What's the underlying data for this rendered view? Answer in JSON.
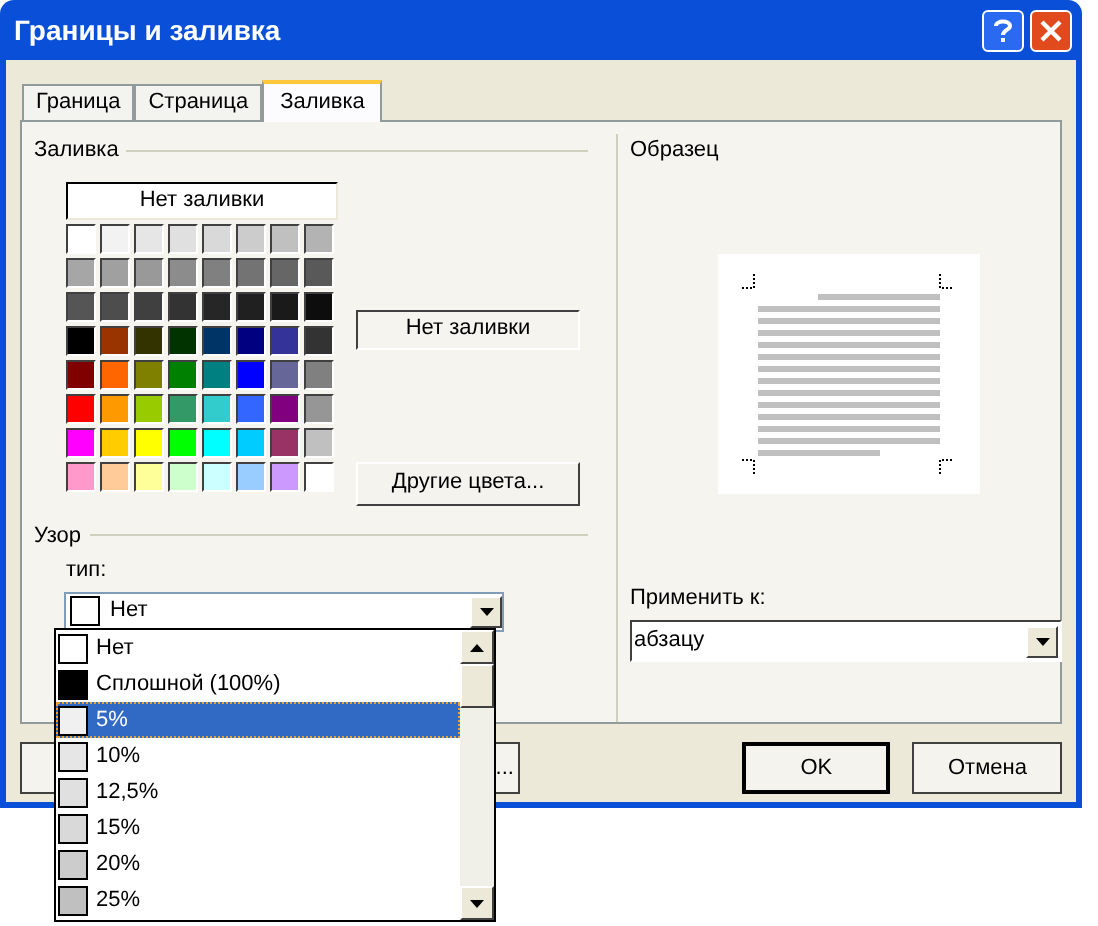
{
  "window": {
    "title": "Границы и заливка"
  },
  "tabs": [
    {
      "label": "Граница",
      "selected": false
    },
    {
      "label": "Страница",
      "selected": false
    },
    {
      "label": "Заливка",
      "selected": true
    }
  ],
  "fill": {
    "title": "Заливка",
    "no_fill_button": "Нет заливки",
    "palette": [
      {
        "swatches": [
          {
            "color": "#ffffff"
          },
          {
            "color": "#f2f2f2"
          },
          {
            "color": "#e6e6e6"
          },
          {
            "color": "#e0e0e0"
          },
          {
            "color": "#d9d9d9"
          },
          {
            "color": "#cccccc"
          },
          {
            "color": "#c0c0c0"
          },
          {
            "color": "#b3b3b3"
          }
        ]
      },
      {
        "swatches": [
          {
            "color": "#a6a6a6"
          },
          {
            "color": "#a0a0a0"
          },
          {
            "color": "#999999"
          },
          {
            "color": "#8c8c8c"
          },
          {
            "color": "#808080"
          },
          {
            "color": "#737373"
          },
          {
            "color": "#666666"
          },
          {
            "color": "#595959"
          }
        ]
      },
      {
        "swatches": [
          {
            "color": "#555555"
          },
          {
            "color": "#4d4d4d"
          },
          {
            "color": "#404040"
          },
          {
            "color": "#333333"
          },
          {
            "color": "#262626"
          },
          {
            "color": "#202020"
          },
          {
            "color": "#1a1a1a"
          },
          {
            "color": "#0d0d0d"
          }
        ]
      },
      {
        "swatches": [
          {
            "color": "#000000"
          },
          {
            "color": "#993300"
          },
          {
            "color": "#333300"
          },
          {
            "color": "#003300"
          },
          {
            "color": "#003366"
          },
          {
            "color": "#000080"
          },
          {
            "color": "#333399"
          },
          {
            "color": "#333333"
          }
        ]
      },
      {
        "swatches": [
          {
            "color": "#800000"
          },
          {
            "color": "#ff6600"
          },
          {
            "color": "#808000"
          },
          {
            "color": "#008000"
          },
          {
            "color": "#008080"
          },
          {
            "color": "#0000ff"
          },
          {
            "color": "#666699"
          },
          {
            "color": "#808080"
          }
        ]
      },
      {
        "swatches": [
          {
            "color": "#ff0000"
          },
          {
            "color": "#ff9900"
          },
          {
            "color": "#99cc00"
          },
          {
            "color": "#339966"
          },
          {
            "color": "#33cccc"
          },
          {
            "color": "#3366ff"
          },
          {
            "color": "#800080"
          },
          {
            "color": "#969696"
          }
        ]
      },
      {
        "swatches": [
          {
            "color": "#ff00ff"
          },
          {
            "color": "#ffcc00"
          },
          {
            "color": "#ffff00"
          },
          {
            "color": "#00ff00"
          },
          {
            "color": "#00ffff"
          },
          {
            "color": "#00ccff"
          },
          {
            "color": "#993366"
          },
          {
            "color": "#c0c0c0"
          }
        ]
      },
      {
        "swatches": [
          {
            "color": "#ff99cc"
          },
          {
            "color": "#ffcc99"
          },
          {
            "color": "#ffff99"
          },
          {
            "color": "#ccffcc"
          },
          {
            "color": "#ccffff"
          },
          {
            "color": "#99ccff"
          },
          {
            "color": "#cc99ff"
          },
          {
            "color": "#ffffff"
          }
        ]
      }
    ],
    "current": "Нет заливки",
    "more_colors_button": "Другие цвета..."
  },
  "pattern": {
    "title": "Узор",
    "type_label": "тип:",
    "current_type": {
      "label": "Нет",
      "color": "#ffffff"
    },
    "options": [
      {
        "label": "Нет",
        "color": "#ffffff",
        "selected": false
      },
      {
        "label": "Сплошной (100%)",
        "color": "#000000",
        "selected": false
      },
      {
        "label": "5%",
        "color": "#f0f0f0",
        "selected": true
      },
      {
        "label": "10%",
        "color": "#e6e6e6",
        "selected": false
      },
      {
        "label": "12,5%",
        "color": "#e0e0e0",
        "selected": false
      },
      {
        "label": "15%",
        "color": "#d9d9d9",
        "selected": false
      },
      {
        "label": "20%",
        "color": "#cccccc",
        "selected": false
      },
      {
        "label": "25%",
        "color": "#c0c0c0",
        "selected": false
      }
    ]
  },
  "preview": {
    "title": "Образец",
    "apply_label": "Применить к:",
    "apply_value": "абзацу"
  },
  "buttons": {
    "left": "...",
    "ok": "OK",
    "cancel": "Отмена"
  }
}
